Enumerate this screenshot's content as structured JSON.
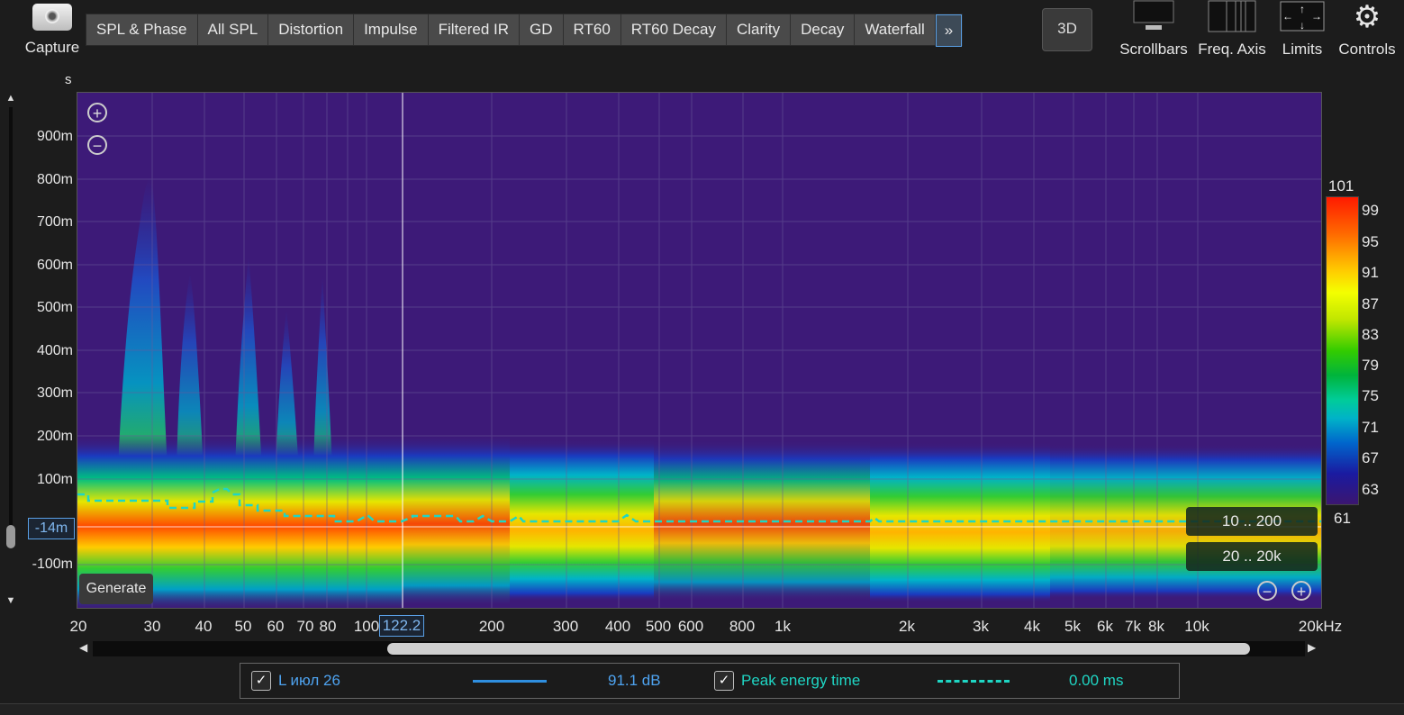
{
  "toolbar": {
    "capture_label": "Capture",
    "tabs": [
      "SPL & Phase",
      "All SPL",
      "Distortion",
      "Impulse",
      "Filtered IR",
      "GD",
      "RT60",
      "RT60 Decay",
      "Clarity",
      "Decay",
      "Waterfall"
    ],
    "more_label": "»",
    "btn_3d": "3D",
    "tools": [
      "Scrollbars",
      "Freq. Axis",
      "Limits",
      "Controls"
    ]
  },
  "plot": {
    "y_unit": "s",
    "y_ticks": [
      "900m",
      "800m",
      "700m",
      "600m",
      "500m",
      "400m",
      "300m",
      "200m",
      "100m",
      "-100m"
    ],
    "y_cursor_value": "-14m",
    "x_ticks": [
      "20",
      "30",
      "40",
      "50",
      "60",
      "70",
      "80",
      "100",
      "200",
      "300",
      "400",
      "500",
      "600",
      "800",
      "1k",
      "2k",
      "3k",
      "4k",
      "5k",
      "6k",
      "7k",
      "8k",
      "10k",
      "20kHz"
    ],
    "x_cursor_value": "122.2",
    "generate_label": "Generate",
    "time_range": "10 .. 200",
    "freq_range": "20 .. 20k",
    "zoom_in": "+",
    "zoom_out": "−"
  },
  "color_scale": {
    "max": "101",
    "min": "61",
    "ticks": [
      "99",
      "95",
      "91",
      "87",
      "83",
      "79",
      "75",
      "71",
      "67",
      "63"
    ]
  },
  "legend": {
    "items": [
      {
        "check": "✓",
        "name": "L июл 26",
        "value": "91.1 dB",
        "color": "#2f8fe0",
        "style": "solid"
      },
      {
        "check": "✓",
        "name": "Peak energy time",
        "value": "0.00 ms",
        "color": "#1fd6c4",
        "style": "dashed"
      }
    ]
  },
  "colors": {
    "background": "#1c1c1c",
    "plot_background": "#3d1a78",
    "accent": "#5aa0e6"
  }
}
